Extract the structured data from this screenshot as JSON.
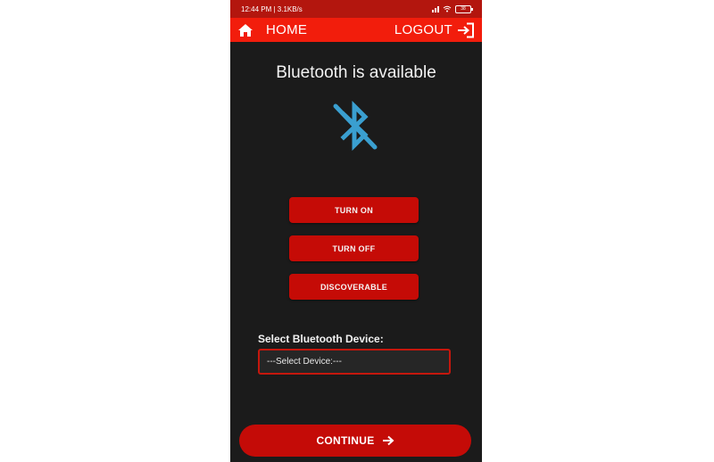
{
  "status_bar": {
    "time_speed": "12:44 PM | 3.1KB/s",
    "battery": "38"
  },
  "app_bar": {
    "home_label": "HOME",
    "home_icon": "home-icon",
    "logout_label": "LOGOUT",
    "logout_icon": "logout-icon"
  },
  "main": {
    "title": "Bluetooth is available",
    "bluetooth_icon": "bluetooth-disabled-icon",
    "buttons": [
      {
        "label": "TURN ON"
      },
      {
        "label": "TURN OFF"
      },
      {
        "label": "DISCOVERABLE"
      }
    ],
    "select_label": "Select Bluetooth Device:",
    "select_value": "---Select Device:---",
    "continue_label": "CONTINUE",
    "continue_icon": "arrow-right-icon"
  },
  "colors": {
    "app_bar": "#f21d0c",
    "status_bar": "#b3160e",
    "background": "#1b1b1b",
    "button": "#c50b06",
    "bluetooth_icon": "#3a9fd0"
  }
}
